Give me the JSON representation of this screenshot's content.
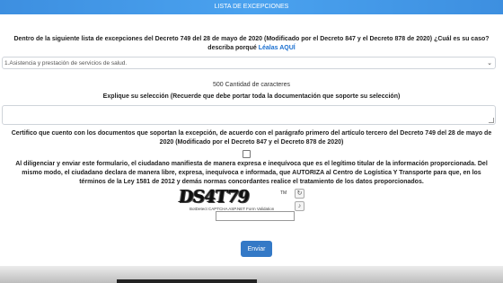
{
  "header": {
    "title": "LISTA DE EXCEPCIONES"
  },
  "question": {
    "line1": "Dentro de la siguiente lista de excepciones del Decreto 749 del 28 de mayo de 2020 (Modificado por el Decreto 847 y el Decreto 878 de 2020) ¿Cuál es su caso?",
    "line2_prefix": "describa porqué",
    "link": "Léalas AQUÍ"
  },
  "exception_select": {
    "selected": "1.Asistencia y prestación de servicios de salud."
  },
  "char_count": "500 Cantidad de caracteres",
  "explain_label": "Explique su selección (Recuerde que debe portar toda la documentación que soporte su selección)",
  "explain_textarea": {
    "value": ""
  },
  "certify": {
    "line1": "Certifico que cuento con los documentos que soportan la excepción, de acuerdo con el parágrafo primero del artículo tercero del Decreto 749 del 28 de mayo de",
    "line2": "2020 (Modificado por el Decreto 847 y el Decreto 878 de 2020)"
  },
  "authorize": {
    "line1": "Al diligenciar y enviar este formulario, el ciudadano manifiesta de manera expresa e inequívoca que es el legítimo titular de la información proporcionada. Del",
    "line2": "mismo modo, el ciudadano declara de manera libre, expresa, inequívoca e informada, que AUTORIZA al Centro de Logística Y Transporte para que, en los",
    "line3": "términos de la Ley 1581 de 2012 y demás normas concordantes realice el tratamiento de los datos proporcionados."
  },
  "captcha": {
    "image_text": "DS4T79",
    "tm": "TM",
    "footer": "BotDetect CAPTCHA ASP.NET Form Validation",
    "input_value": "",
    "refresh_icon": "refresh-icon",
    "sound_icon": "sound-icon"
  },
  "submit": {
    "label": "Enviar"
  },
  "colors": {
    "header": "#4aa2ef",
    "button": "#3479c6",
    "link": "#1a6fd0"
  }
}
